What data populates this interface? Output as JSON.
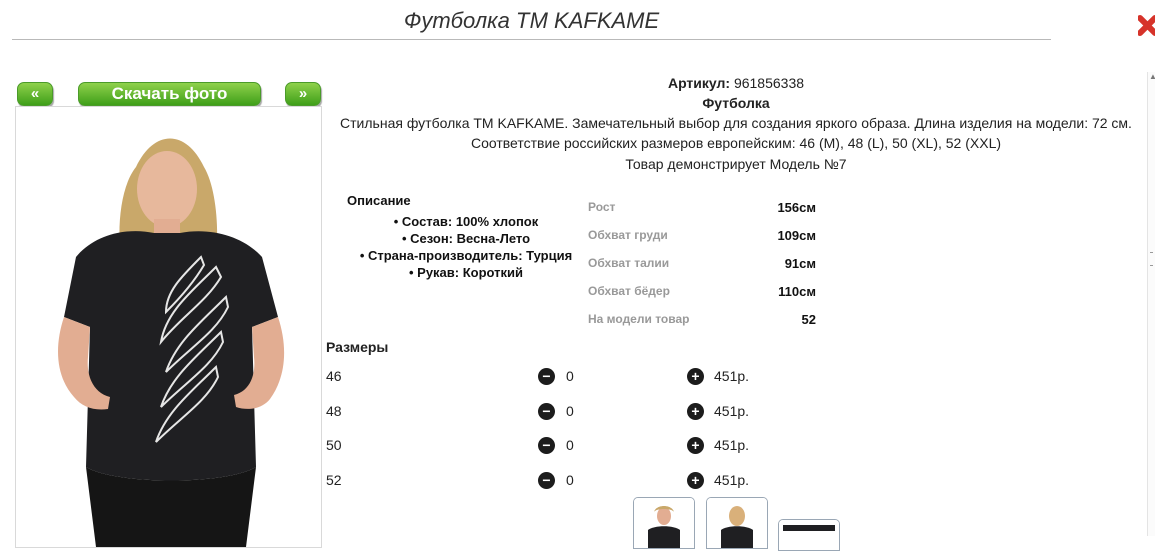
{
  "header": {
    "title": "Футболка ТМ KAFKAME"
  },
  "gallery": {
    "prev_label": "«",
    "download_label": "Скачать фото",
    "next_label": "»"
  },
  "product": {
    "article_label": "Артикул:",
    "article_value": "961856338",
    "category": "Футболка",
    "description_line1": "Стильная футболка ТМ KAFKAME. Замечательный выбор для создания яркого образа. Длина изделия на модели: 72 см.",
    "description_line2": "Соответствие российских размеров европейским: 46 (M), 48 (L), 50 (XL), 52 (XXL)",
    "model_line": "Товар демонстрирует Модель №7"
  },
  "details": {
    "heading": "Описание",
    "features": [
      "• Состав: 100% хлопок",
      "• Сезон: Весна-Лето",
      "• Страна-производитель: Турция",
      "• Рукав: Короткий"
    ]
  },
  "measurements": [
    {
      "label": "Рост",
      "value": "156см"
    },
    {
      "label": "Обхват груди",
      "value": "109см"
    },
    {
      "label": "Обхват талии",
      "value": "91см"
    },
    {
      "label": "Обхват бёдер",
      "value": "110см"
    },
    {
      "label": "На модели товар",
      "value": "52"
    }
  ],
  "sizes": {
    "heading": "Размеры",
    "minus_symbol": "−",
    "plus_symbol": "+",
    "rows": [
      {
        "size": "46",
        "qty": "0",
        "price": "451р."
      },
      {
        "size": "48",
        "qty": "0",
        "price": "451р."
      },
      {
        "size": "50",
        "qty": "0",
        "price": "451р."
      },
      {
        "size": "52",
        "qty": "0",
        "price": "451р."
      }
    ]
  },
  "colors": {
    "button_green": "#4ea624",
    "shirt": "#1f1f22",
    "close_red": "#d6332a"
  }
}
